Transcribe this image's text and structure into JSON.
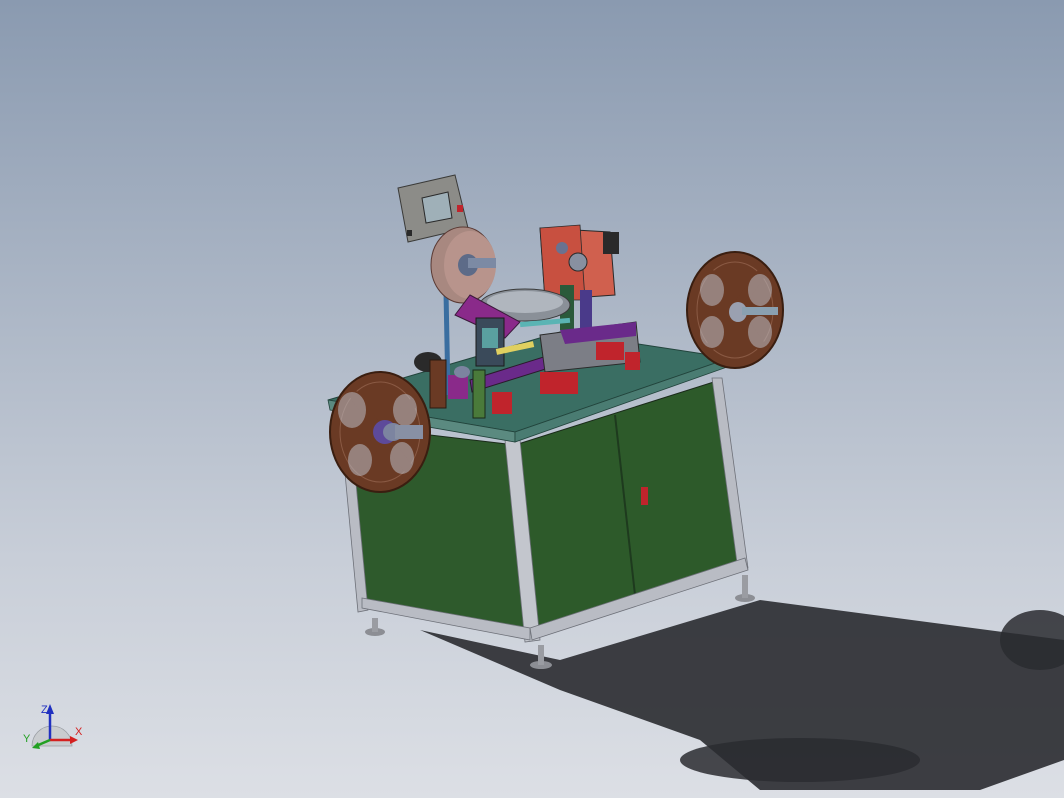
{
  "triad": {
    "x_label": "X",
    "y_label": "Y",
    "z_label": "Z",
    "x_color": "#d42020",
    "y_color": "#22a022",
    "z_color": "#2030c0"
  },
  "colors": {
    "cabinet_green": "#2e5a2c",
    "frame_gray": "#b9bcc4",
    "tabletop": "#3a6e63",
    "reel_brown": "#6a3a24",
    "red_block": "#c0242c",
    "purple_part": "#8a2a8a",
    "control_box": "#8c8c88"
  }
}
